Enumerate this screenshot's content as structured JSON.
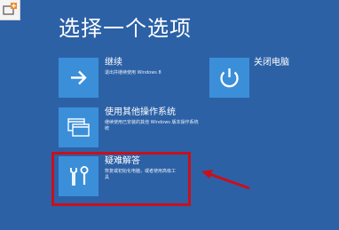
{
  "screen": {
    "title": "选择一个选项"
  },
  "options": {
    "continue": {
      "label": "继续",
      "description": "退出并继续使用 Windows 8",
      "icon": "arrow-right-icon"
    },
    "shutdown": {
      "label": "关闭电脑",
      "icon": "power-icon"
    },
    "other_os": {
      "label": "使用其他操作系统",
      "description": "继续使用已安装的其他 Windows 版本操作系统",
      "description_line2": "统",
      "icon": "windows-stack-icon"
    },
    "troubleshoot": {
      "label": "疑难解答",
      "description": "恢复或初始化电脑，或者使用高级工",
      "description_line2": "具",
      "icon": "tools-icon"
    }
  },
  "annotation": {
    "highlight_color": "#c8101d",
    "arrow_color": "#c8101d"
  },
  "colors": {
    "background": "#2c61a6",
    "tile": "#3b8fd9"
  }
}
